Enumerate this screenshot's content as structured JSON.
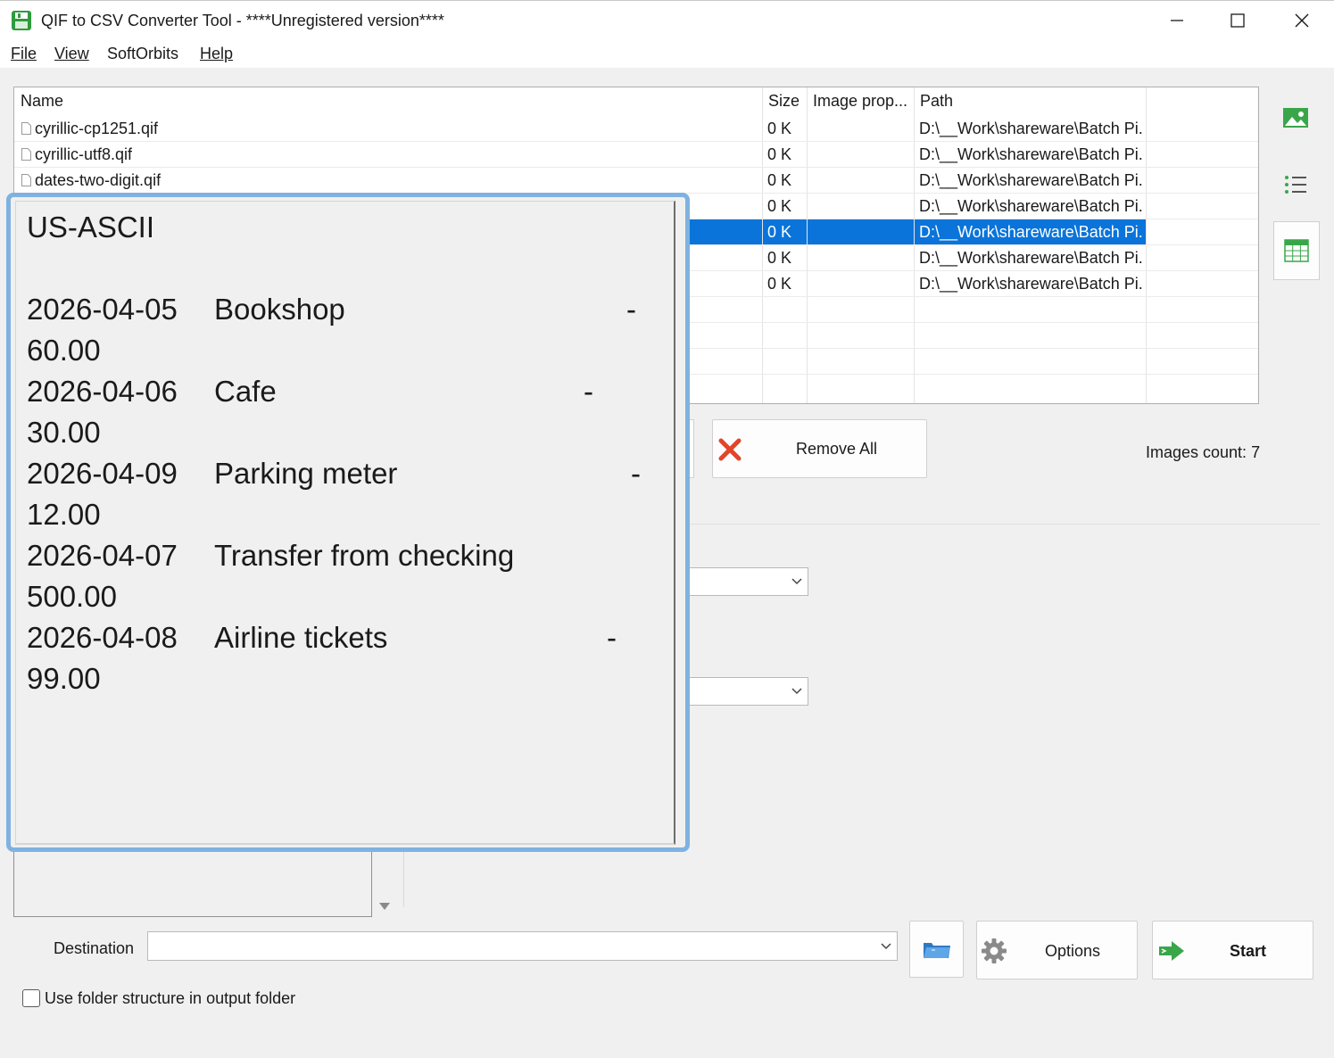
{
  "window": {
    "title": "QIF to CSV Converter Tool - ****Unregistered version****",
    "controls": [
      "minimize",
      "maximize",
      "close"
    ]
  },
  "menu": {
    "file": "File",
    "view": "View",
    "softorbits": "SoftOrbits",
    "help": "Help"
  },
  "file_list": {
    "columns": {
      "name": "Name",
      "size": "Size",
      "image_prop": "Image prop...",
      "path": "Path"
    },
    "rows": [
      {
        "name": "cyrillic-cp1251.qif",
        "size": "0 K",
        "path": "D:\\__Work\\shareware\\Batch Pi..."
      },
      {
        "name": "cyrillic-utf8.qif",
        "size": "0 K",
        "path": "D:\\__Work\\shareware\\Batch Pi..."
      },
      {
        "name": "dates-two-digit.qif",
        "size": "0 K",
        "path": "D:\\__Work\\shareware\\Batch Pi..."
      },
      {
        "name": "",
        "size": "0 K",
        "path": "D:\\__Work\\shareware\\Batch Pi..."
      },
      {
        "name": "",
        "size": "0 K",
        "path": "D:\\__Work\\shareware\\Batch Pi...",
        "selected": true
      },
      {
        "name": "",
        "size": "0 K",
        "path": "D:\\__Work\\shareware\\Batch Pi..."
      },
      {
        "name": "",
        "size": "0 K",
        "path": "D:\\__Work\\shareware\\Batch Pi..."
      }
    ]
  },
  "buttons": {
    "remove_all": "Remove All",
    "options": "Options",
    "start": "Start"
  },
  "images_count": "Images count: 7",
  "destination": {
    "label": "Destination",
    "value": ""
  },
  "use_folder_structure": {
    "label": "Use folder structure in output folder",
    "checked": false
  },
  "preview_popup": {
    "encoding": "US-ASCII",
    "transactions": [
      {
        "date": "2026-04-05",
        "payee": "Bookshop",
        "sign": "-",
        "amount": "60.00"
      },
      {
        "date": "2026-04-06",
        "payee": "Cafe",
        "sign": "-",
        "amount": "30.00"
      },
      {
        "date": "2026-04-09",
        "payee": "Parking meter",
        "sign": "-",
        "amount": "12.00"
      },
      {
        "date": "2026-04-07",
        "payee": "Transfer from checking",
        "sign": "",
        "amount": "500.00"
      },
      {
        "date": "2026-04-08",
        "payee": "Airline tickets",
        "sign": "-",
        "amount": "99.00"
      }
    ]
  },
  "colors": {
    "selection": "#0a74da",
    "popup_border": "#7fb2e0",
    "accent_green": "#3aa64a",
    "remove_red": "#e1452a"
  }
}
